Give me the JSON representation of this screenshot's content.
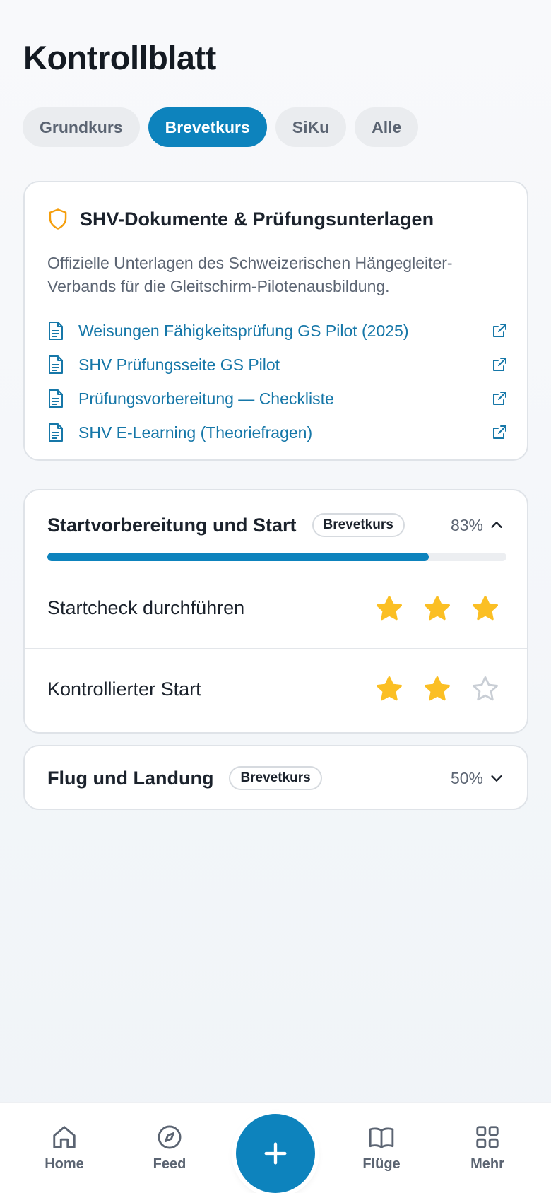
{
  "header": {
    "title": "Kontrollblatt"
  },
  "tabs": [
    {
      "label": "Grundkurs",
      "active": false
    },
    {
      "label": "Brevetkurs",
      "active": true
    },
    {
      "label": "SiKu",
      "active": false
    },
    {
      "label": "Alle",
      "active": false
    }
  ],
  "documents": {
    "icon": "shield-icon",
    "title": "SHV-Dokumente & Prüfungsunterlagen",
    "description": "Offizielle Unterlagen des Schweizerischen Hängegleiter-Verbands für die Gleitschirm-Pilotenausbildung.",
    "links": [
      {
        "label": "Weisungen Fähigkeitsprüfung GS Pilot (2025)"
      },
      {
        "label": "SHV Prüfungsseite GS Pilot"
      },
      {
        "label": "Prüfungsvorbereitung — Checkliste"
      },
      {
        "label": "SHV E-Learning (Theoriefragen)"
      }
    ]
  },
  "sections": [
    {
      "title": "Startvorbereitung und Start",
      "badge": "Brevetkurs",
      "percent_label": "83%",
      "progress": 0.83,
      "expanded": true,
      "skills": [
        {
          "name": "Startcheck durchführen",
          "rating": 3,
          "max": 3
        },
        {
          "name": "Kontrollierter Start",
          "rating": 2,
          "max": 3
        }
      ]
    },
    {
      "title": "Flug und Landung",
      "badge": "Brevetkurs",
      "percent_label": "50%",
      "progress": 0.5,
      "expanded": false
    }
  ],
  "nav": {
    "items": [
      {
        "label": "Home",
        "icon": "home-icon"
      },
      {
        "label": "Feed",
        "icon": "compass-icon"
      },
      {
        "label": "Flüge",
        "icon": "book-icon"
      },
      {
        "label": "Mehr",
        "icon": "grid-icon"
      }
    ],
    "fab_icon": "plus-icon"
  },
  "colors": {
    "accent": "#0d83bd",
    "link": "#1677a8",
    "star_filled": "#fbbf24",
    "star_empty": "#c9ced5",
    "shield": "#f59e0b"
  }
}
